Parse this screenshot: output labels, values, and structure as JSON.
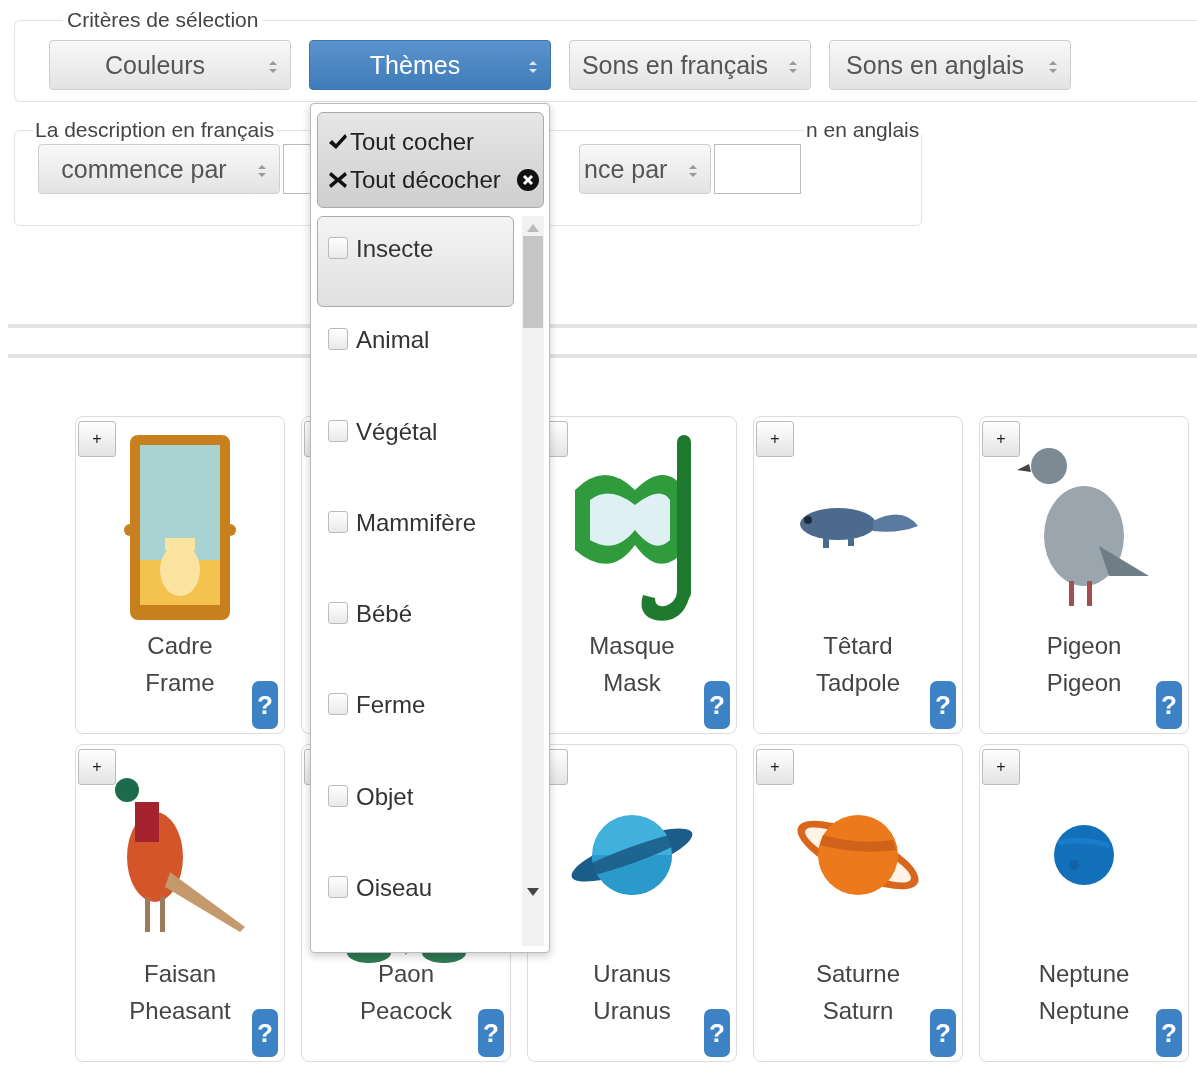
{
  "criteria": {
    "legend": "Critères de sélection",
    "selects": [
      {
        "label": "Couleurs",
        "selected": false
      },
      {
        "label": "Thèmes",
        "selected": true
      },
      {
        "label": "Sons en français",
        "selected": false
      },
      {
        "label": "Sons en anglais",
        "selected": false
      }
    ]
  },
  "description_fr": {
    "legend": "La description en français",
    "mode": "commence par"
  },
  "description_en": {
    "legend": "n en anglais",
    "mode": "nce par"
  },
  "dropdown": {
    "actions": [
      {
        "kind": "check_all",
        "label": "Tout cocher"
      },
      {
        "kind": "uncheck_all",
        "label": "Tout décocher"
      }
    ],
    "items": [
      {
        "label": "Insecte",
        "checked": false,
        "highlighted": true
      },
      {
        "label": "Animal",
        "checked": false,
        "highlighted": false
      },
      {
        "label": "Végétal",
        "checked": false,
        "highlighted": false
      },
      {
        "label": "Mammifère",
        "checked": false,
        "highlighted": false
      },
      {
        "label": "Bébé",
        "checked": false,
        "highlighted": false
      },
      {
        "label": "Ferme",
        "checked": false,
        "highlighted": false
      },
      {
        "label": "Objet",
        "checked": false,
        "highlighted": false
      },
      {
        "label": "Oiseau",
        "checked": false,
        "highlighted": false
      }
    ]
  },
  "cards": [
    {
      "add_button": true,
      "plus": "+",
      "fr": "Cadre",
      "en": "Frame",
      "help": "?"
    },
    {
      "add_button": true
    },
    {
      "add_button": true,
      "fr": "Masque",
      "en": "Mask",
      "help": "?"
    },
    {
      "add_button": true,
      "plus": "+",
      "fr": "Têtard",
      "en": "Tadpole",
      "help": "?"
    },
    {
      "add_button": true,
      "plus": "+",
      "fr": "Pigeon",
      "en": "Pigeon",
      "help": "?"
    },
    {
      "add_button": true,
      "plus": "+",
      "fr": "Faisan",
      "en": "Pheasant",
      "help": "?"
    },
    {
      "add_button": true,
      "fr": "Paon",
      "en": "Peacock",
      "help": "?"
    },
    {
      "add_button": true,
      "fr": "Uranus",
      "en": "Uranus",
      "help": "?"
    },
    {
      "add_button": true,
      "plus": "+",
      "fr": "Saturne",
      "en": "Saturn",
      "help": "?"
    },
    {
      "add_button": true,
      "plus": "+",
      "fr": "Neptune",
      "en": "Neptune",
      "help": "?"
    }
  ]
}
